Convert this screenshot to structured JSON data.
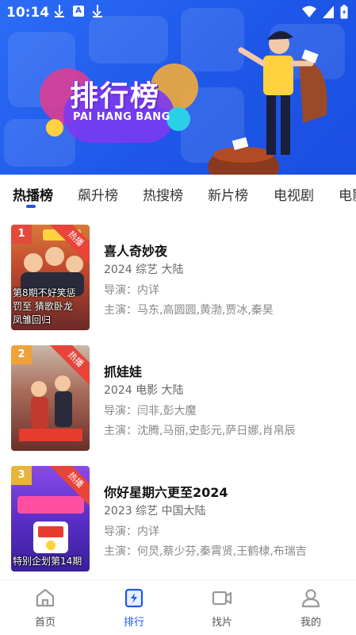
{
  "status_bar": {
    "time": "10:14",
    "notification_letter": "A"
  },
  "banner": {
    "title": "排行榜",
    "subtitle": "PAI HANG BANG"
  },
  "tabs": [
    {
      "label": "热播榜",
      "active": true
    },
    {
      "label": "飙升榜",
      "active": false
    },
    {
      "label": "热搜榜",
      "active": false
    },
    {
      "label": "新片榜",
      "active": false
    },
    {
      "label": "电视剧",
      "active": false
    },
    {
      "label": "电影",
      "active": false
    }
  ],
  "list": [
    {
      "rank": "1",
      "badge": "热播",
      "poster_caption": "第8期不好笑惩\n罚至 猜歌卧龙\n凤雏回归",
      "title": "喜人奇妙夜",
      "meta": "2024  综艺  大陆",
      "director": "导演：内详",
      "cast": "主演：马东,高圆圆,黄渤,贾冰,秦昊",
      "colors": {
        "rank_bg": "#e24a3b",
        "poster_bg": "#c8623a"
      }
    },
    {
      "rank": "2",
      "badge": "热播",
      "poster_caption": "",
      "title": "抓娃娃",
      "meta": "2024  电影  大陆",
      "director": "导演：闫非,彭大魔",
      "cast": "主演：沈腾,马丽,史彭元,萨日娜,肖帛辰",
      "colors": {
        "rank_bg": "#f0a13a",
        "poster_bg": "#b85a4a"
      }
    },
    {
      "rank": "3",
      "badge": "热播",
      "poster_caption": "特别企划第14期",
      "title": "你好星期六更至2024",
      "meta": "2023  综艺  中国大陆",
      "director": "导演：内详",
      "cast": "主演：何炅,蔡少芬,秦霄贤,王鹤棣,布瑞吉",
      "colors": {
        "rank_bg": "#e8b43a",
        "poster_bg": "#6a3fd0"
      }
    }
  ],
  "bottom_nav": [
    {
      "label": "首页",
      "icon": "home-icon",
      "active": false
    },
    {
      "label": "排行",
      "icon": "ranking-icon",
      "active": true
    },
    {
      "label": "找片",
      "icon": "video-camera-icon",
      "active": false
    },
    {
      "label": "我的",
      "icon": "user-icon",
      "active": false
    }
  ],
  "colors": {
    "accent": "#1e57e8",
    "badge": "#e8443a"
  }
}
